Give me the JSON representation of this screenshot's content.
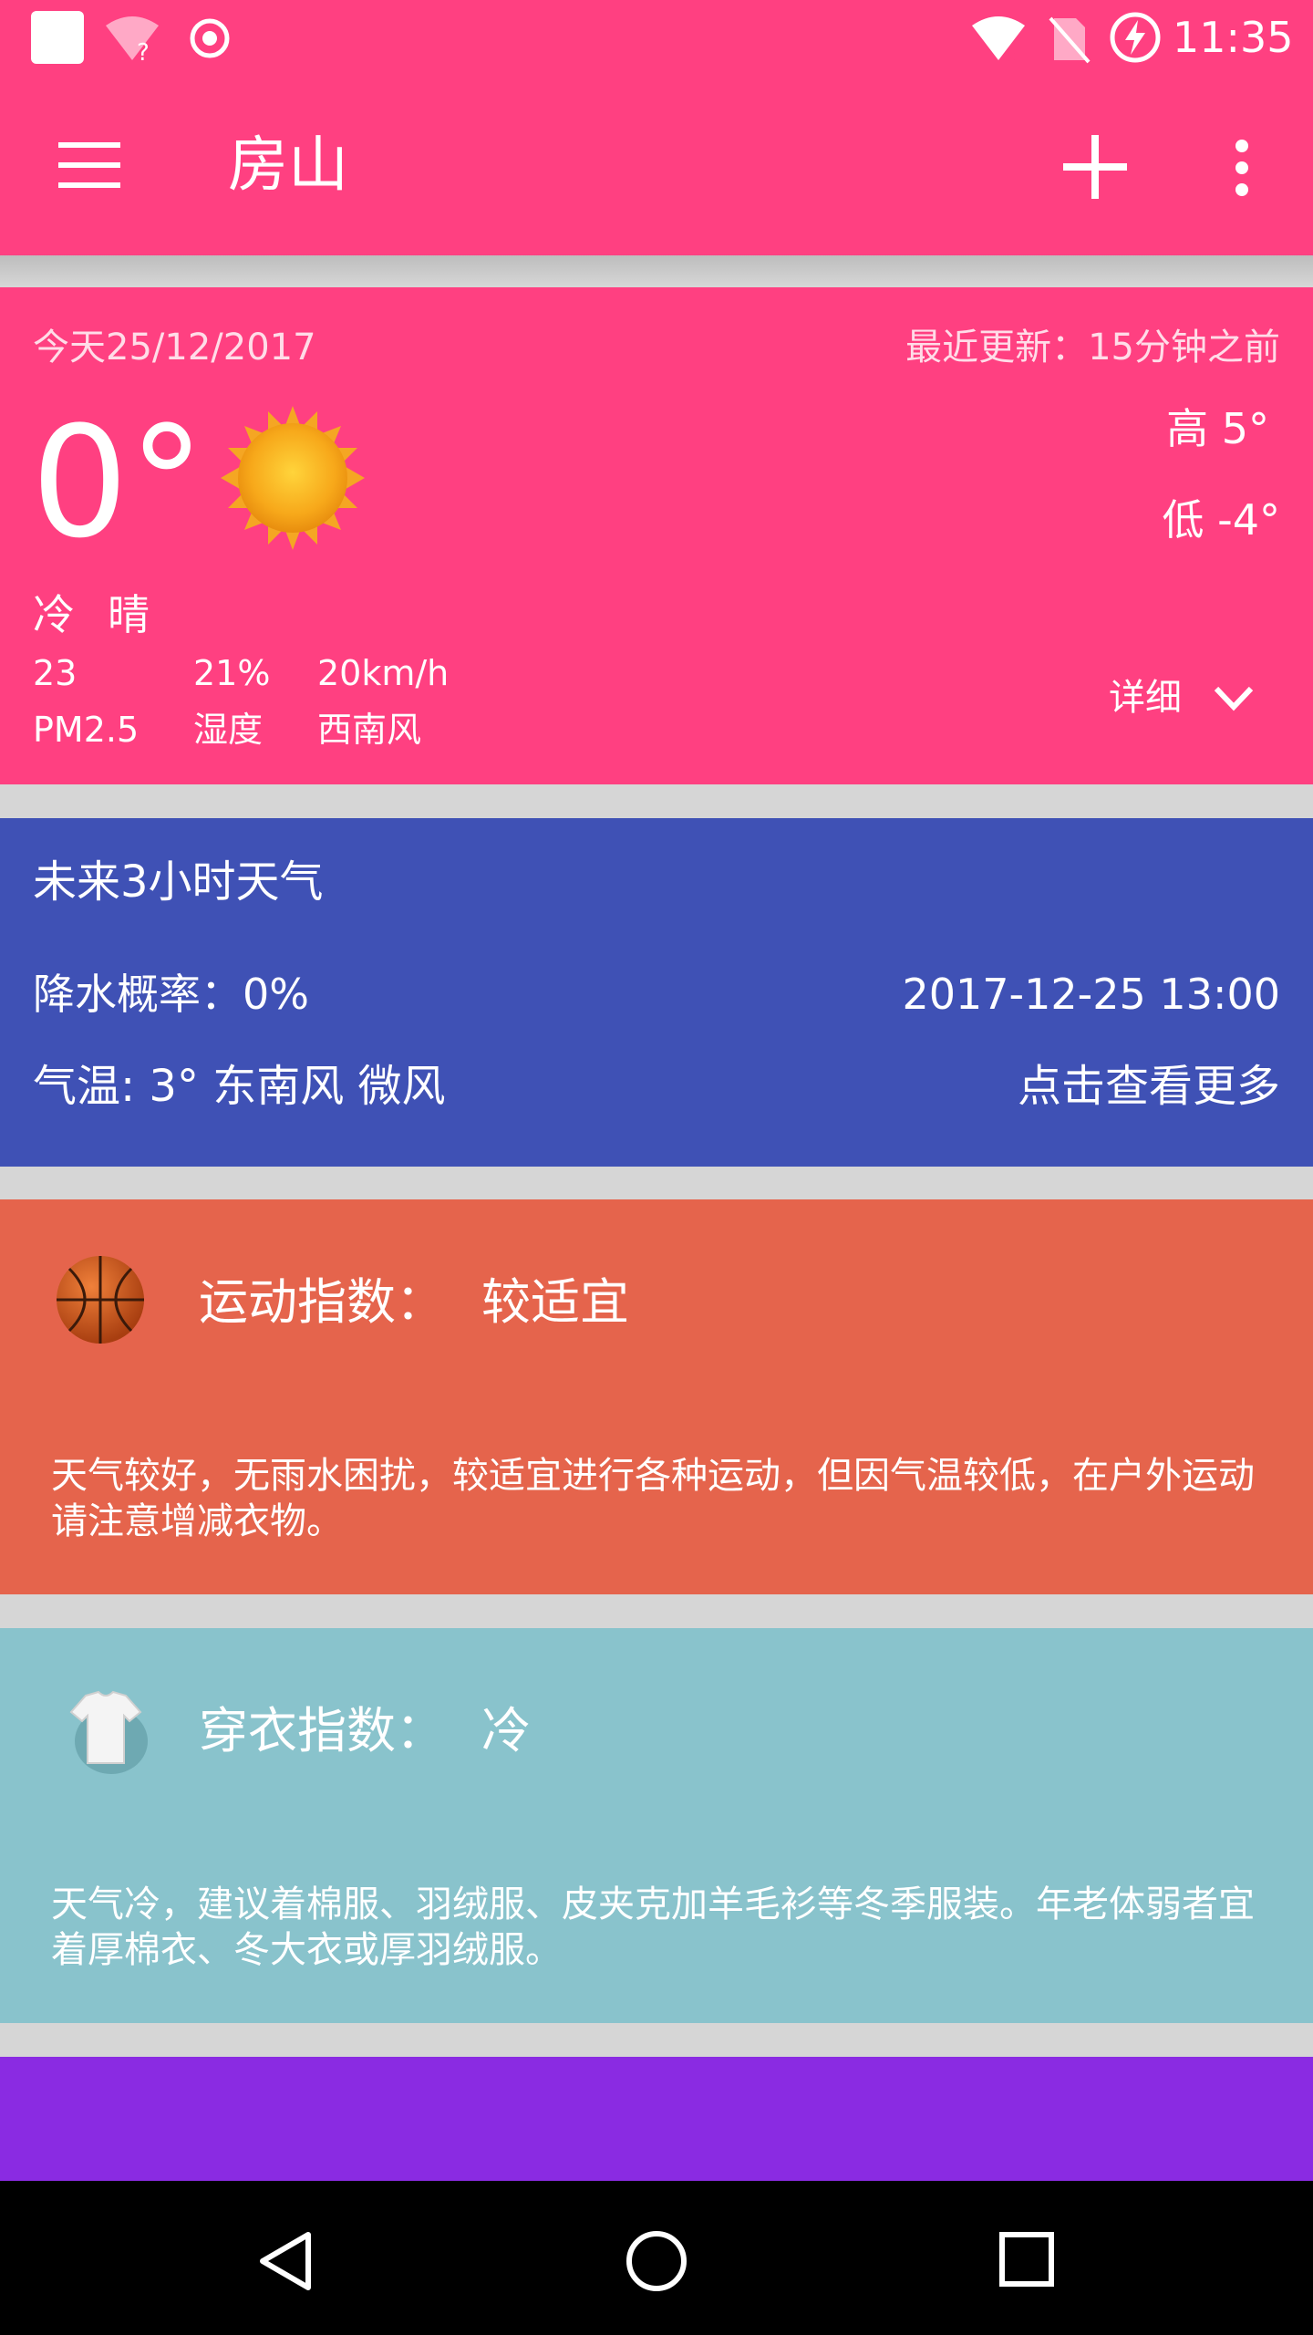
{
  "status_bar": {
    "time": "11:35"
  },
  "toolbar": {
    "title": "房山"
  },
  "today": {
    "date": "今天25/12/2017",
    "updated": "最近更新：15分钟之前",
    "temperature": "0°",
    "high": "高 5°",
    "low": "低 -4°",
    "feel": "冷",
    "condition": "晴",
    "pm_value": "23",
    "pm_label": "PM2.5",
    "humidity_value": "21%",
    "humidity_label": "湿度",
    "wind_value": "20km/h",
    "wind_label": "西南风",
    "detail_label": "详细"
  },
  "forecast3h": {
    "title": "未来3小时天气",
    "precip": "降水概率：0%",
    "datetime": "2017-12-25 13:00",
    "temp_wind": "气温: 3°   东南风 微风",
    "more": "点击查看更多"
  },
  "sport_index": {
    "label": "运动指数：",
    "value": "较适宜",
    "desc": "天气较好，无雨水困扰，较适宜进行各种运动，但因气温较低，在户外运动请注意增减衣物。"
  },
  "clothing_index": {
    "label": "穿衣指数：",
    "value": "冷",
    "desc": "天气冷，建议着棉服、羽绒服、皮夹克加羊毛衫等冬季服装。年老体弱者宜着厚棉衣、冬大衣或厚羽绒服。"
  },
  "colors": {
    "pink": "#ff4081",
    "indigo": "#3f51b5",
    "coral": "#e5644c",
    "teal": "#89c3cc",
    "purple": "#8a2be2"
  },
  "icons": [
    "menu-icon",
    "add-icon",
    "more-vert-icon",
    "sun-icon",
    "chevron-down-icon",
    "basketball-icon",
    "tshirt-icon",
    "back-icon",
    "home-icon",
    "recents-icon",
    "wifi-icon",
    "battery-icon",
    "no-sim-icon"
  ]
}
